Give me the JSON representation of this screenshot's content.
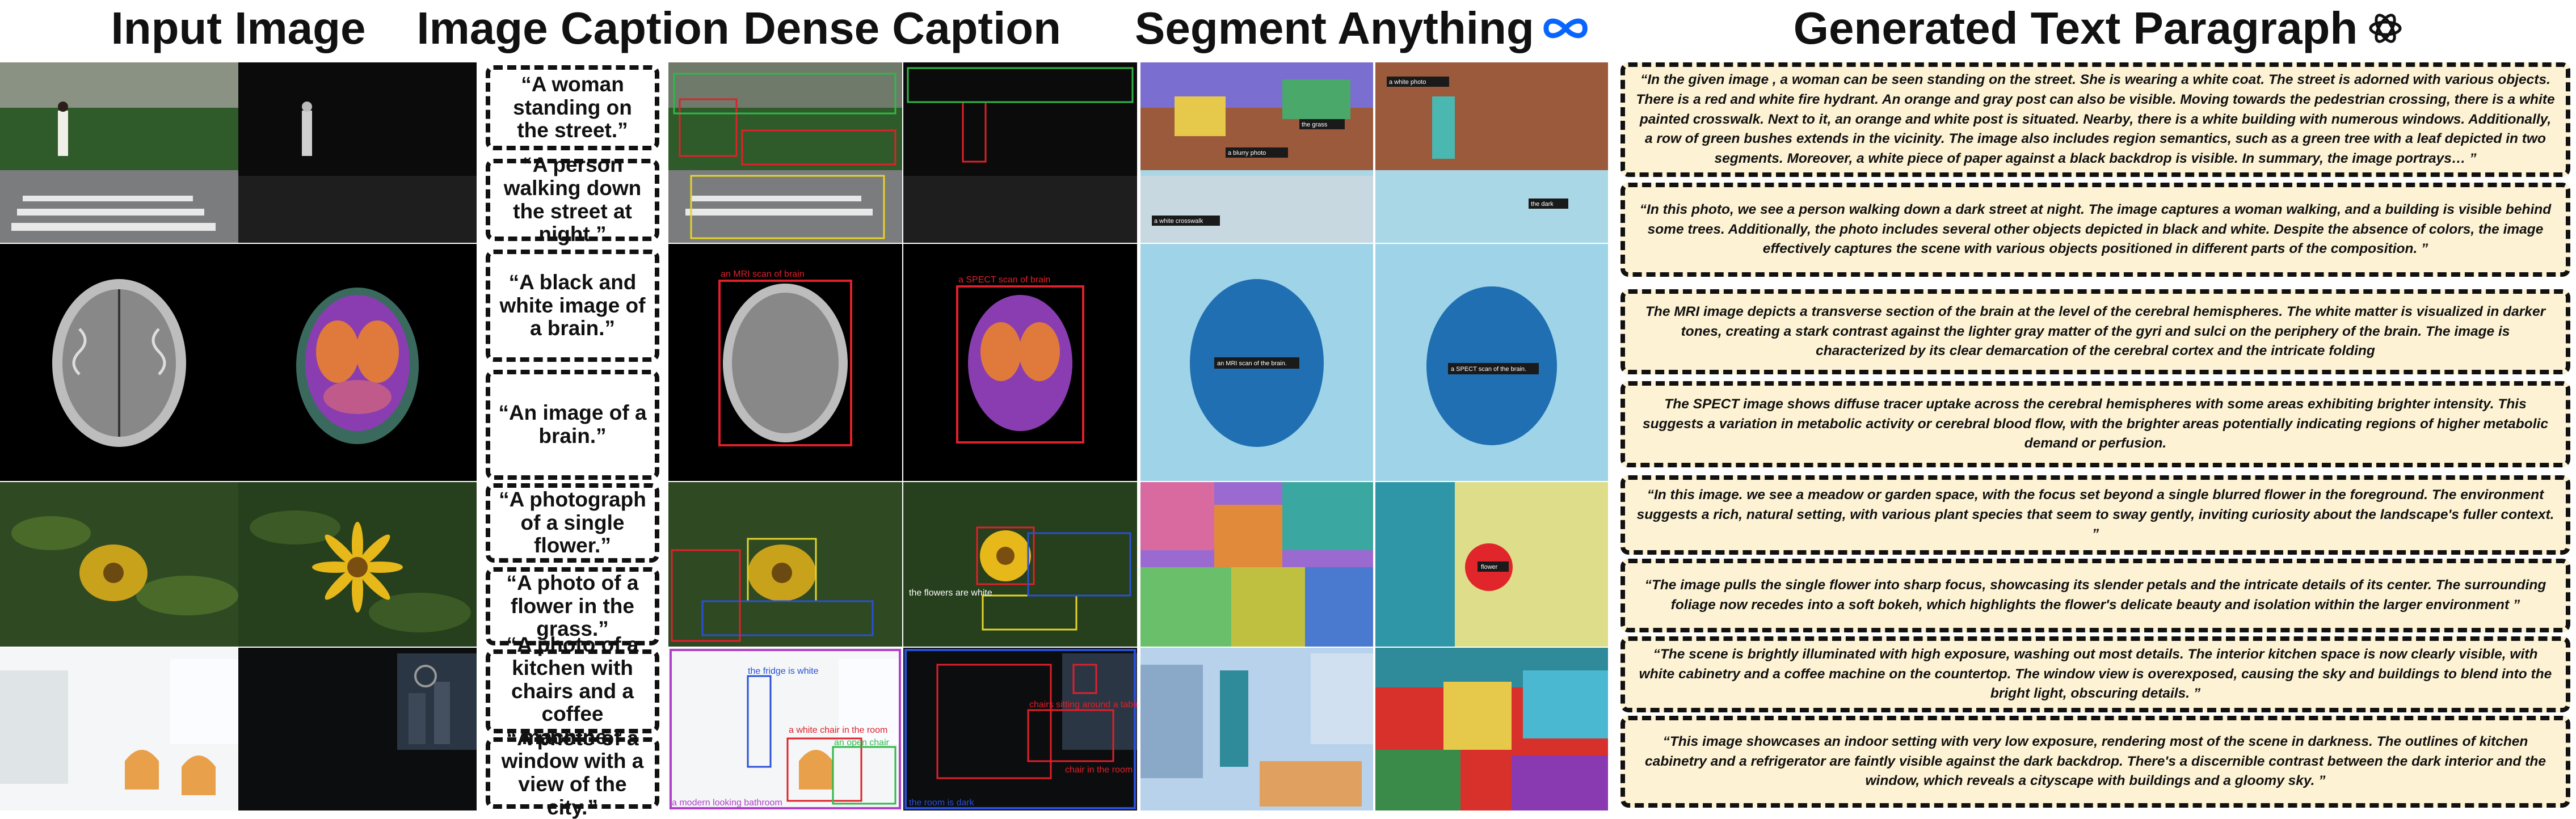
{
  "headers": {
    "input_image": "Input Image",
    "image_caption": "Image Caption",
    "dense_caption": "Dense Caption",
    "segment_anything": "Segment Anything",
    "generated_text": "Generated Text Paragraph"
  },
  "captions": [
    "“A woman standing on the street.”",
    "“A person walking down the street at night.”",
    "“A black and white image of a brain.”",
    "“An image of a brain.”",
    "“A photograph of a single flower.”",
    "“A photo of a flower in the grass.”",
    "“A photo of a kitchen with chairs and a coffee machine.”",
    "“A photo of a window with a view of the city.”"
  ],
  "dense_labels": {
    "mri": "an MRI scan of brain",
    "spect": "a SPECT scan of brain",
    "flower_white": "the flowers are white",
    "fridge": "the fridge is white",
    "chair_room": "a white chair in the room",
    "open_chair": "an open chair",
    "bathroom": "a modern looking bathroom",
    "chairs_table": "chairs sitting around a table",
    "chair_room2": "chair in the room",
    "room_dark": "the room is dark"
  },
  "segment_labels": {
    "mri": "an MRI scan of the brain.",
    "spect": "a SPECT scan of the brain.",
    "flower": "flower",
    "white_crosswalk": "a white crosswalk",
    "blurry_photo": "a blurry photo",
    "the_grass": "the grass",
    "the_dark": "the dark",
    "white_photo": "a white photo"
  },
  "paragraphs": [
    "“In the given image , a woman can be seen standing on the street. She is wearing a white coat. The street is adorned with various objects. There is a red and white fire hydrant. An orange and gray post can also be visible. Moving towards the pedestrian crossing, there is a white painted crosswalk. Next to it, an orange and white post is situated. Nearby, there is a white building with numerous windows. Additionally, a row of green bushes extends in the vicinity. The image also includes region semantics, such as a green tree with a leaf depicted in two segments. Moreover, a white piece of paper against a black backdrop is visible. In summary, the image portrays… ”",
    "“In this photo, we see a person walking down a dark street at night. The image captures a woman walking, and a building is visible behind some trees. Additionally, the photo includes several other objects depicted in black and white. Despite the absence of colors, the image effectively captures the scene with various objects positioned in different parts of the composition. ”",
    "The MRI image depicts a transverse section of the brain at the level of the cerebral hemispheres. The white matter is visualized in darker tones, creating a stark contrast against the lighter gray matter of the gyri and sulci on the periphery of the brain. The image is characterized by its clear demarcation of the cerebral cortex and the intricate folding",
    "The SPECT image shows diffuse tracer uptake across the cerebral hemispheres with some areas exhibiting brighter intensity. This suggests a variation in metabolic activity or cerebral blood flow, with the brighter areas potentially indicating regions of higher metabolic demand or perfusion.",
    "“In this image. we see a meadow or garden space, with the focus set beyond a single blurred flower in the foreground. The environment suggests a rich, natural setting, with various plant species that seem to sway gently, inviting curiosity about the landscape's fuller context. ”",
    "“The image pulls the single flower into sharp focus, showcasing its slender petals and the intricate details of its center. The surrounding foliage now recedes into a soft bokeh, which highlights the flower's delicate beauty and isolation within the larger environment ”",
    "“The scene is brightly illuminated with high exposure, washing out most details. The interior kitchen space is now clearly visible, with white cabinetry and a coffee machine on the countertop. The window view is overexposed, causing the sky and buildings to blend into the bright light, obscuring details. ”",
    "“This image showcases an indoor setting with very low exposure, rendering most of the scene in darkness. The outlines of kitchen cabinetry and a refrigerator are faintly visible against the dark backdrop. There's a discernible contrast between the dark interior and the window, which reveals a cityscape with buildings and a gloomy sky. ”"
  ],
  "icons": {
    "meta": "meta-infinity-logo",
    "openai": "openai-knot-logo"
  },
  "colors": {
    "meta_blue": "#0866ff",
    "paragraph_bg": "#fdf2d3",
    "box_red": "#e0202a"
  }
}
